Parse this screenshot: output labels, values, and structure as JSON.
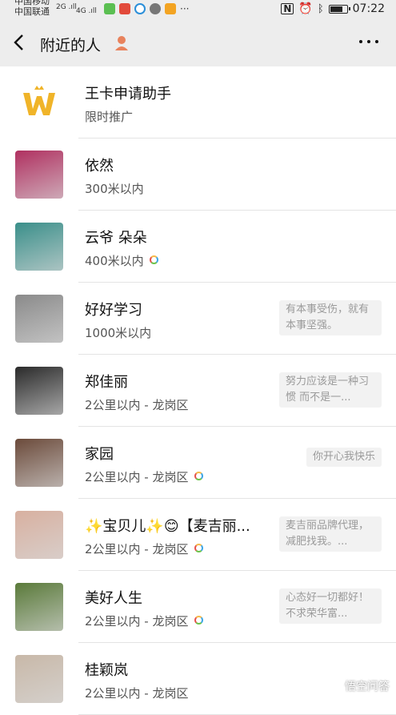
{
  "status_bar": {
    "carrier_1": "中国移动",
    "carrier_2": "中国联通",
    "signal_1": "2G .ıll",
    "signal_2": "4G .ıll",
    "more": "···",
    "time": "07:22",
    "nfc_icon": "nfc-icon",
    "alarm_icon": "alarm-icon",
    "bluetooth_icon": "bluetooth-icon",
    "battery_level": 0.8
  },
  "header": {
    "title": "附近的人",
    "person_icon": "person-icon",
    "more_icon": "more-icon",
    "back_icon": "back-arrow-icon"
  },
  "people": [
    {
      "name": "王卡申请助手",
      "distance": "限时推广",
      "signature": "",
      "avatar": "wangka-logo",
      "avatar_color": "#f0b429"
    },
    {
      "name": "依然",
      "distance": "300米以内",
      "signature": "",
      "avatar": "flowers-photo",
      "avatar_color": "#b03060"
    },
    {
      "name": "云爷  朵朵",
      "distance": "400米以内",
      "signature": "",
      "avatar": "woman-portrait",
      "avatar_color": "#3a8f8a",
      "online_dot": true
    },
    {
      "name": "好好学习",
      "distance": "1000米以内",
      "signature": "有本事受伤，就有本事坚强。",
      "avatar": "walking-figure",
      "avatar_color": "#8a8a8a"
    },
    {
      "name": "郑佳丽",
      "distance": "2公里以内 - 龙岗区",
      "signature": "努力应该是一种习惯 而不是一...",
      "avatar": "man-in-suit",
      "avatar_color": "#2a2a2a"
    },
    {
      "name": "家园",
      "distance": "2公里以内 - 龙岗区",
      "signature": "你开心我快乐",
      "avatar": "woman-portrait-2",
      "avatar_color": "#6b4a3a",
      "online_dot": true
    },
    {
      "name": "✨宝贝儿✨😊【麦吉丽...",
      "distance": "2公里以内 - 龙岗区",
      "signature": "麦吉丽品牌代理，减肥找我。...",
      "avatar": "woman-portrait-3",
      "avatar_color": "#d8b0a0",
      "online_dot": true
    },
    {
      "name": "美好人生",
      "distance": "2公里以内 - 龙岗区",
      "signature": "心态好一切都好！不求荣华富...",
      "avatar": "flower-basket",
      "avatar_color": "#5a7a3a",
      "online_dot": true
    },
    {
      "name": "桂颖岚",
      "distance": "2公里以内 - 龙岗区",
      "signature": "",
      "avatar": "sketch-girl",
      "avatar_color": "#c8b8a8"
    }
  ],
  "watermark": {
    "text": "悟空问答",
    "icon": "wukong-logo-icon"
  },
  "colors": {
    "bar_bg": "#ededed",
    "accent_orange": "#f0b429",
    "person_icon": "#e8825c"
  }
}
